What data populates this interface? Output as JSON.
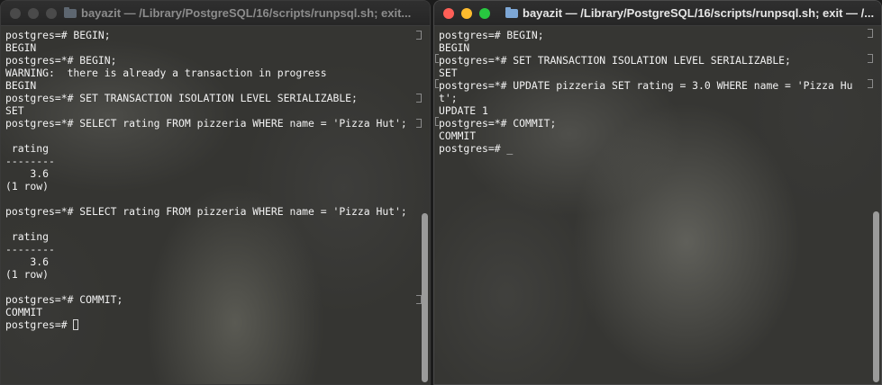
{
  "left_window": {
    "title": "bayazit — /Library/PostgreSQL/16/scripts/runpsql.sh; exit...",
    "lines": [
      "postgres=# BEGIN;",
      "BEGIN",
      "postgres=*# BEGIN;",
      "WARNING:  there is already a transaction in progress",
      "BEGIN",
      "postgres=*# SET TRANSACTION ISOLATION LEVEL SERIALIZABLE;",
      "SET",
      "postgres=*# SELECT rating FROM pizzeria WHERE name = 'Pizza Hut';",
      "",
      " rating",
      "--------",
      "    3.6",
      "(1 row)",
      "",
      "postgres=*# SELECT rating FROM pizzeria WHERE name = 'Pizza Hut';",
      "",
      " rating",
      "--------",
      "    3.6",
      "(1 row)",
      "",
      "postgres=*# COMMIT;",
      "COMMIT",
      "postgres=# "
    ]
  },
  "right_window": {
    "title": "bayazit — /Library/PostgreSQL/16/scripts/runpsql.sh; exit — /...",
    "lines": [
      "postgres=# BEGIN;",
      "BEGIN",
      "postgres=*# SET TRANSACTION ISOLATION LEVEL SERIALIZABLE;",
      "SET",
      "postgres=*# UPDATE pizzeria SET rating = 3.0 WHERE name = 'Pizza Hu",
      "t';",
      "UPDATE 1",
      "postgres=*# COMMIT;",
      "COMMIT",
      "postgres=# _"
    ]
  }
}
